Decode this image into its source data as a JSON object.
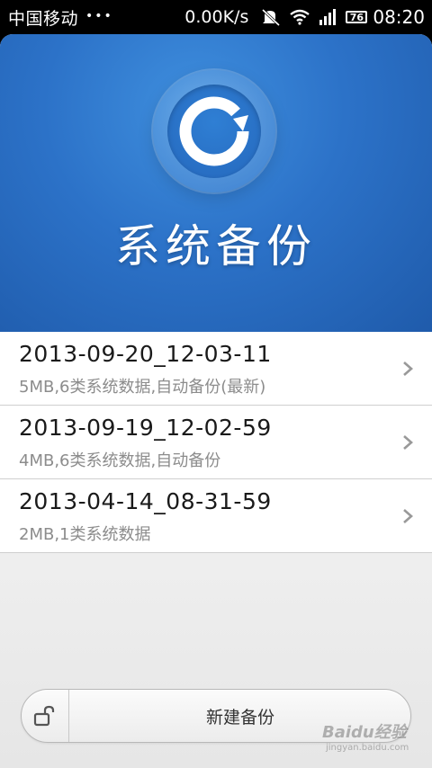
{
  "status_bar": {
    "carrier": "中国移动",
    "dots": "•••",
    "speed": "0.00K/s",
    "battery": "76",
    "time": "08:20",
    "icons": [
      "mute-icon",
      "wifi-icon",
      "signal-icon",
      "battery-icon"
    ]
  },
  "banner": {
    "title": "系统备份",
    "logo_icon": "backup-restore-icon"
  },
  "backups": [
    {
      "name": "2013-09-20_12-03-11",
      "detail": "5MB,6类系统数据,自动备份(最新)"
    },
    {
      "name": "2013-09-19_12-02-59",
      "detail": "4MB,6类系统数据,自动备份"
    },
    {
      "name": "2013-04-14_08-31-59",
      "detail": "2MB,1类系统数据"
    }
  ],
  "bottom": {
    "new_backup_label": "新建备份",
    "lock_icon": "unlock-icon"
  },
  "watermark": {
    "main": "Baidu经验",
    "sub": "jingyan.baidu.com"
  },
  "colors": {
    "banner_blue": "#2c72c8",
    "text_primary": "#1a1a1a",
    "text_secondary": "#8c8c8c"
  }
}
